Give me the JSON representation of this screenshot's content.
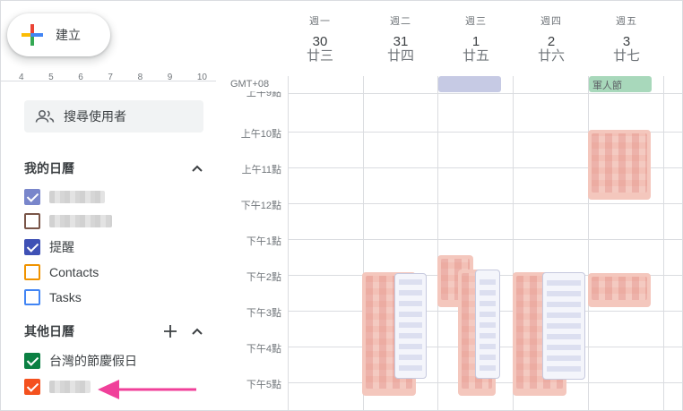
{
  "create": {
    "label": "建立"
  },
  "mini_calendar": {
    "visible_dates": [
      "4",
      "5",
      "6",
      "7",
      "8",
      "9",
      "10"
    ]
  },
  "search_users": {
    "placeholder": "搜尋使用者"
  },
  "my_calendars": {
    "title": "我的日曆",
    "items": [
      {
        "label": "",
        "checked": true,
        "color": "#7986cb"
      },
      {
        "label": "",
        "checked": false,
        "color": "#795548"
      },
      {
        "label": "提醒",
        "checked": true,
        "color": "#3f51b5"
      },
      {
        "label": "Contacts",
        "checked": false,
        "color": "#f09300"
      },
      {
        "label": "Tasks",
        "checked": false,
        "color": "#4285f4"
      }
    ]
  },
  "other_calendars": {
    "title": "其他日曆",
    "items": [
      {
        "label": "台灣的節慶假日",
        "checked": true,
        "color": "#0b8043"
      },
      {
        "label": "",
        "checked": true,
        "color": "#f4511e"
      }
    ]
  },
  "timezone": "GMT+08",
  "days": [
    {
      "dow": "週一",
      "date": "30",
      "lunar": "廿三"
    },
    {
      "dow": "週二",
      "date": "31",
      "lunar": "廿四"
    },
    {
      "dow": "週三",
      "date": "1",
      "lunar": "廿五"
    },
    {
      "dow": "週四",
      "date": "2",
      "lunar": "廿六"
    },
    {
      "dow": "週五",
      "date": "3",
      "lunar": "廿七"
    }
  ],
  "time_labels": [
    "上午9點",
    "上午10點",
    "上午11點",
    "下午12點",
    "下午1點",
    "下午2點",
    "下午3點",
    "下午4點",
    "下午5點"
  ],
  "all_day_events": [
    {
      "day": "週三",
      "label": ""
    },
    {
      "day": "週五",
      "label": "軍人節"
    }
  ],
  "colors": {
    "accent_arrow": "#f0409a",
    "event_salmon": "#f4c7bd",
    "holiday_green": "#a8d8bb"
  }
}
